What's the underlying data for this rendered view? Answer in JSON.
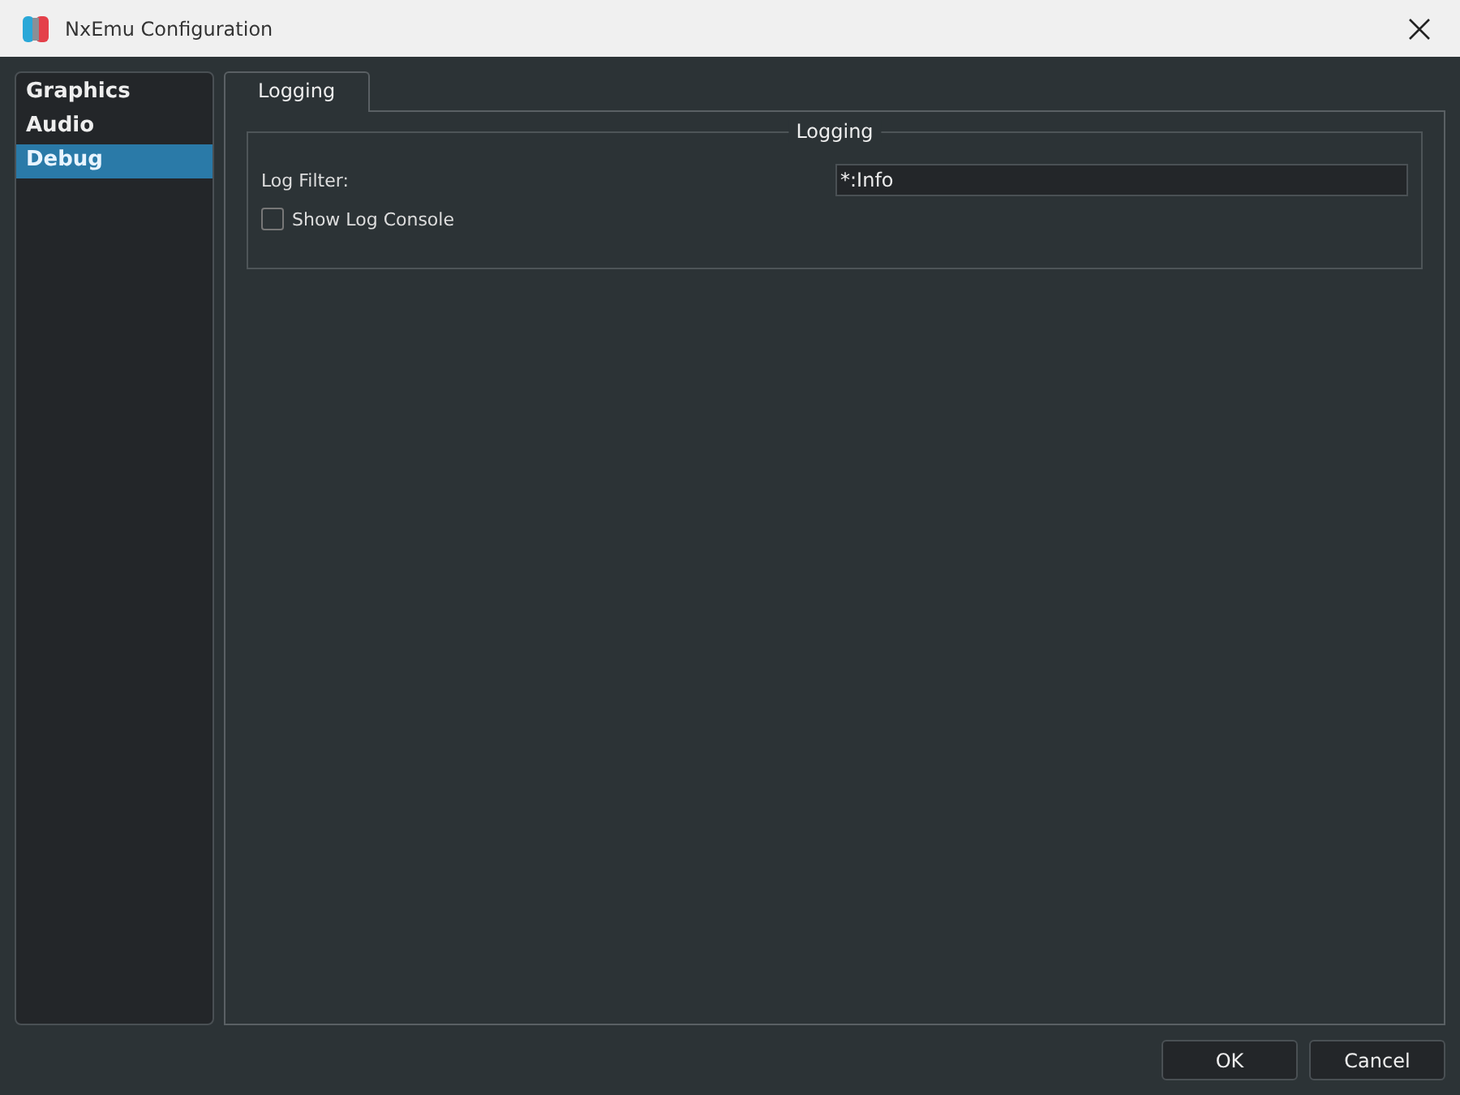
{
  "window": {
    "title": "NxEmu Configuration"
  },
  "sidebar": {
    "items": [
      {
        "label": "Graphics",
        "selected": false
      },
      {
        "label": "Audio",
        "selected": false
      },
      {
        "label": "Debug",
        "selected": true
      }
    ]
  },
  "tabs": [
    {
      "label": "Logging",
      "selected": true
    }
  ],
  "group": {
    "title": "Logging",
    "log_filter": {
      "label": "Log Filter:",
      "value": "*:Info"
    },
    "show_log_console": {
      "label": "Show Log Console",
      "checked": false
    }
  },
  "buttons": [
    "OK",
    "Cancel"
  ]
}
